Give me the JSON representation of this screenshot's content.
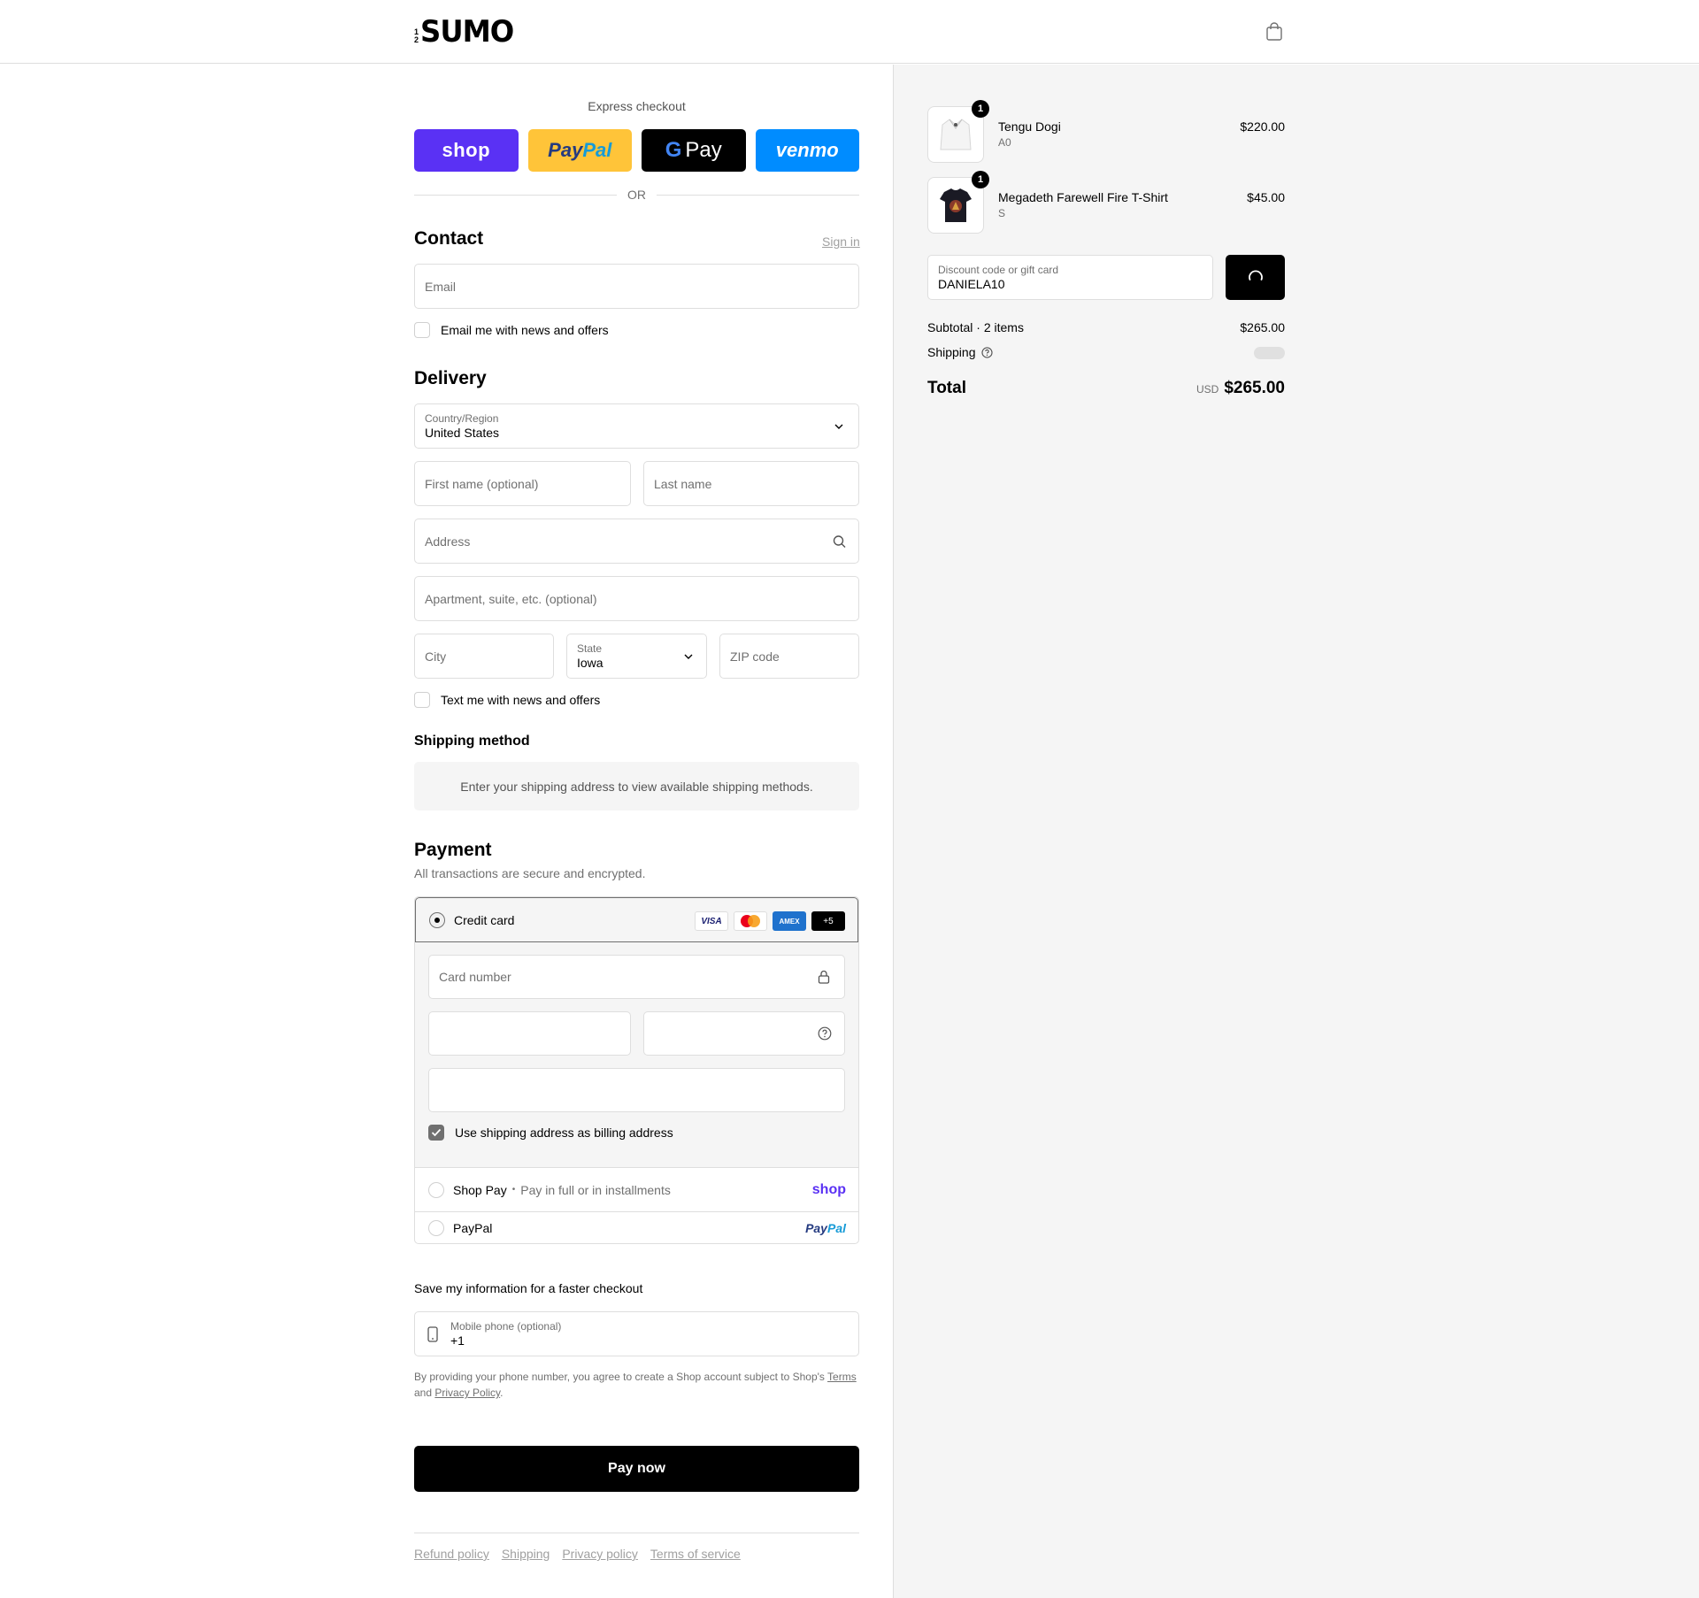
{
  "header": {
    "logo_small_top": "1",
    "logo_small_bottom": "2",
    "logo_text": "SUMO"
  },
  "express": {
    "title": "Express checkout",
    "shop_label": "shop",
    "paypal_part1": "Pay",
    "paypal_part2": "Pal",
    "gpay_g": "G",
    "gpay_label": "Pay",
    "venmo_label": "venmo",
    "or_label": "OR"
  },
  "contact": {
    "title": "Contact",
    "signin_label": "Sign in",
    "email_placeholder": "Email",
    "newsletter_label": "Email me with news and offers"
  },
  "delivery": {
    "title": "Delivery",
    "country_label": "Country/Region",
    "country_value": "United States",
    "first_name_placeholder": "First name (optional)",
    "last_name_placeholder": "Last name",
    "address_placeholder": "Address",
    "apartment_placeholder": "Apartment, suite, etc. (optional)",
    "city_placeholder": "City",
    "state_label": "State",
    "state_value": "Iowa",
    "zip_placeholder": "ZIP code",
    "sms_label": "Text me with news and offers"
  },
  "shipping_method": {
    "title": "Shipping method",
    "info": "Enter your shipping address to view available shipping methods."
  },
  "payment": {
    "title": "Payment",
    "subtitle": "All transactions are secure and encrypted.",
    "credit_card_label": "Credit card",
    "cards": [
      "VISA",
      "",
      "AMEX",
      "+5"
    ],
    "card_number_placeholder": "Card number",
    "billing_label": "Use shipping address as billing address",
    "shoppay_label": "Shop Pay",
    "shoppay_sep": "•",
    "shoppay_desc": "Pay in full or in installments",
    "shoppay_logo": "shop",
    "paypal_label": "PayPal",
    "paypal_logo_1": "Pay",
    "paypal_logo_2": "Pal"
  },
  "save_info": {
    "title": "Save my information for a faster checkout",
    "phone_label": "Mobile phone (optional)",
    "phone_value": "+1",
    "legal_1": "By providing your phone number, you agree to create a Shop account subject to Shop's ",
    "terms_link": "Terms",
    "legal_2": "and ",
    "privacy_link": "Privacy Policy",
    "legal_3": "."
  },
  "pay_now_label": "Pay now",
  "footer_links": [
    "Refund policy",
    "Shipping",
    "Privacy policy",
    "Terms of service"
  ],
  "cart": {
    "items": [
      {
        "name": "Tengu Dogi",
        "variant": "A0",
        "price": "$220.00",
        "qty": "1"
      },
      {
        "name": "Megadeth Farewell Fire T-Shirt",
        "variant": "S",
        "price": "$45.00",
        "qty": "1"
      }
    ],
    "discount_label": "Discount code or gift card",
    "discount_value": "DANIELA10",
    "subtotal_label": "Subtotal · 2 items",
    "subtotal_value": "$265.00",
    "shipping_label": "Shipping",
    "total_label": "Total",
    "currency": "USD",
    "total_value": "$265.00"
  },
  "colors": {
    "shop_purple": "#5a31f4",
    "paypal_yellow": "#ffc439",
    "venmo_blue": "#008cff",
    "primary": "#000000"
  }
}
